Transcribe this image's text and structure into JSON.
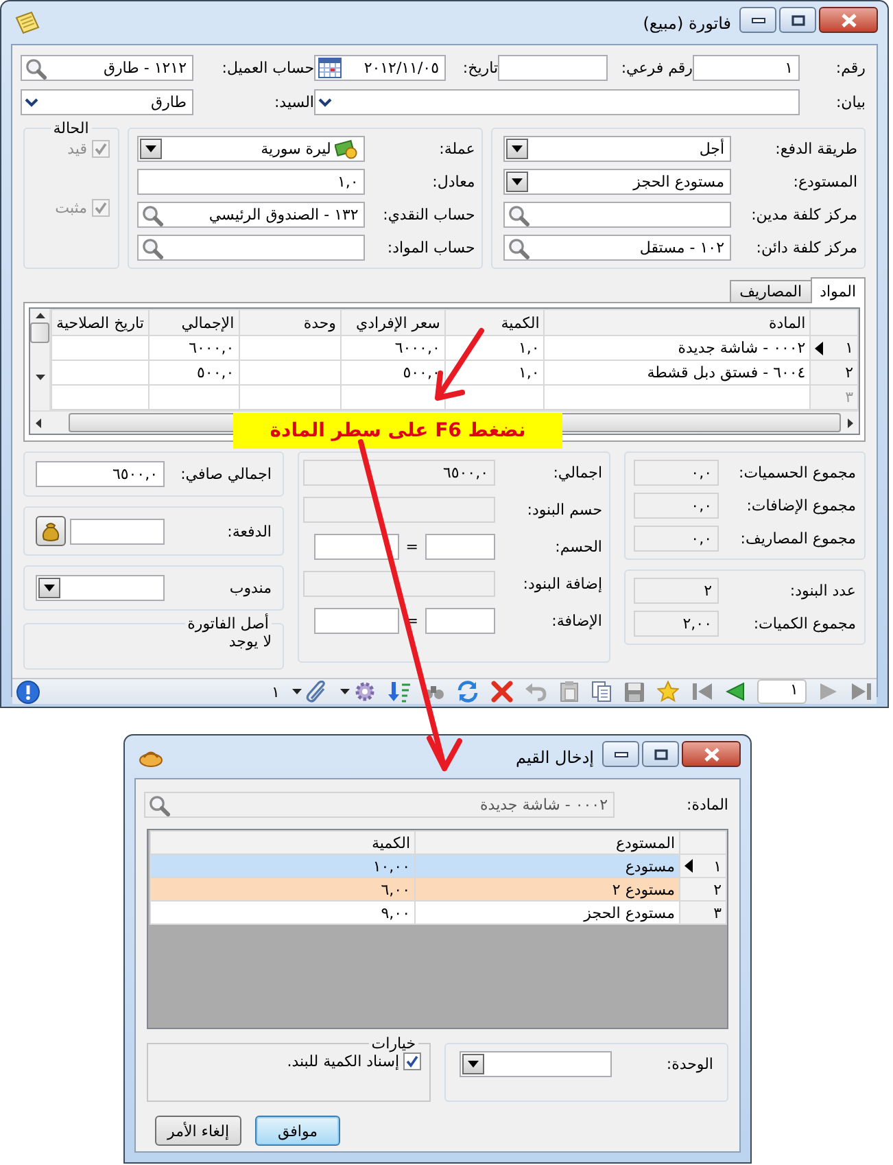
{
  "invoice_window": {
    "title": "فاتورة (مبيع)",
    "header_rows": [
      [
        {
          "label": "رقم:",
          "value": "١",
          "kind": "text"
        },
        {
          "label": "رقم فرعي:",
          "kind": "text"
        },
        {
          "label": "تاريخ:",
          "value": "٢٠١٢/١١/٠٥",
          "kind": "date"
        },
        {
          "label": "حساب العميل:",
          "value": "١٢١٢ - طارق",
          "kind": "search"
        }
      ],
      [
        {
          "label": "بيان:",
          "kind": "dropdown"
        },
        {
          "label": "السيد:",
          "value": "طارق",
          "kind": "dropdown"
        }
      ]
    ],
    "payment_panel": [
      {
        "label": "طريقة الدفع:",
        "value": "أجل",
        "kind": "combo"
      },
      {
        "label": "المستودع:",
        "value": "مستودع  الحجز",
        "kind": "combo"
      },
      {
        "label": "مركز كلفة مدين:",
        "kind": "search"
      },
      {
        "label": "مركز كلفة دائن:",
        "value": "١٠٢ - مستقل",
        "kind": "search"
      }
    ],
    "currency_panel": [
      {
        "label": "عملة:",
        "value": "ليرة سورية",
        "kind": "currency-combo"
      },
      {
        "label": "معادل:",
        "value": "١,٠",
        "kind": "text"
      },
      {
        "label": "حساب النقدي:",
        "value": "١٣٢ - الصندوق الرئيسي",
        "kind": "search"
      },
      {
        "label": "حساب المواد:",
        "kind": "search"
      }
    ],
    "status_group": {
      "title": "الحالة",
      "checkboxes": [
        {
          "label": "قيد",
          "checked": true,
          "disabled": true
        },
        {
          "label": "مثبت",
          "checked": true,
          "disabled": true
        }
      ]
    },
    "tabs": [
      {
        "label": "المواد",
        "selected": true
      },
      {
        "label": "المصاريف",
        "selected": false
      }
    ],
    "items_table": {
      "columns": [
        "المادة",
        "الكمية",
        "سعر الإفرادي",
        "وحدة",
        "الإجمالي",
        "تاريخ الصلاحية"
      ],
      "rows": [
        {
          "number": "١",
          "selected": true,
          "cells": [
            "٠٠٠٢ - شاشة جديدة",
            "١,٠",
            "٦٠٠٠,٠",
            null,
            "٦٠٠٠,٠",
            null
          ]
        },
        {
          "number": "٢",
          "selected": false,
          "cells": [
            "٦٠٠٤ - فستق دبل قشطة",
            "١,٠",
            "٥٠٠,٠",
            null,
            "٥٠٠,٠",
            null
          ]
        },
        {
          "number": "٣",
          "selected": false,
          "cells": [
            null,
            null,
            null,
            null,
            null,
            null
          ]
        }
      ]
    },
    "totals_panel": [
      {
        "label": "مجموع الحسميات:",
        "value": "٠,٠",
        "kind": "readonly"
      },
      {
        "label": "مجموع الإضافات:",
        "value": "٠,٠",
        "kind": "readonly"
      },
      {
        "label": "مجموع المصاريف:",
        "value": "٠,٠",
        "kind": "readonly"
      }
    ],
    "count_panel": [
      {
        "label": "عدد البنود:",
        "value": "٢",
        "kind": "readonly"
      },
      {
        "label": "مجموع الكميات:",
        "value": "٢,٠٠",
        "kind": "readonly"
      }
    ],
    "amounts_panel": [
      {
        "label": "اجمالي:",
        "value": "٦٥٠٠,٠",
        "kind": "readonly"
      },
      {
        "label": "حسم البنود:",
        "kind": "readonly"
      },
      {
        "label": "الحسم:",
        "kind": "pair",
        "sign": "="
      },
      {
        "label": "إضافة البنود:",
        "kind": "readonly"
      },
      {
        "label": "الإضافة:",
        "kind": "pair",
        "sign": "="
      }
    ],
    "net_field": {
      "label": "اجمالي صافي:",
      "value": "٦٥٠٠,٠",
      "kind": "text"
    },
    "payment_field": {
      "label": "الدفعة:",
      "kind": "payment"
    },
    "agent_field": {
      "label": "مندوب",
      "kind": "combo"
    },
    "origin_group": {
      "title": "أصل الفاتورة",
      "value": "لا يوجد"
    },
    "toolbar": {
      "attachment_count": "١",
      "page": "١"
    }
  },
  "callout": {
    "text": "نضغط F6 على سطر المادة"
  },
  "values_dialog": {
    "title": "إدخال القيم",
    "item_field": {
      "label": "المادة:",
      "value": "٠٠٠٢ - شاشة جديدة",
      "kind": "search",
      "disabled": true
    },
    "table": {
      "columns": [
        "المستودع",
        "الكمية"
      ],
      "rows": [
        {
          "number": "١",
          "selected": true,
          "color": "#c5dff8",
          "cells": [
            "مستودع",
            "١٠,٠٠"
          ]
        },
        {
          "number": "٢",
          "selected": false,
          "color": "#fcd9b8",
          "cells": [
            "مستودع ٢",
            "٦,٠٠"
          ]
        },
        {
          "number": "٣",
          "selected": false,
          "color": "#ffffff",
          "cells": [
            "مستودع  الحجز",
            "٩,٠٠"
          ]
        }
      ]
    },
    "unit_field": {
      "label": "الوحدة:",
      "kind": "combo"
    },
    "options_group": {
      "title": "خيارات",
      "checkboxes": [
        {
          "label": "إسناد الكمية للبند.",
          "checked": true,
          "disabled": false
        }
      ]
    },
    "buttons": [
      {
        "label": "موافق",
        "default": true
      },
      {
        "label": "إلغاء الأمر",
        "default": false
      }
    ]
  }
}
